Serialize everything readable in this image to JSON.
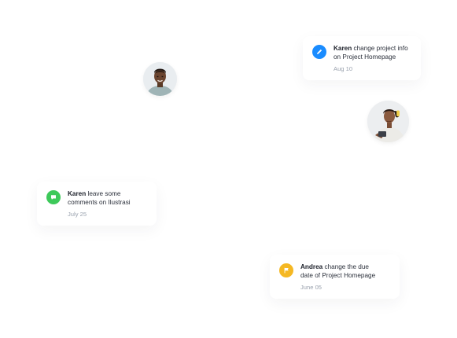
{
  "colors": {
    "pencil_badge": "#1a8cff",
    "comment_badge": "#3dc95a",
    "flag_badge": "#f5b823",
    "background": "#ffffff"
  },
  "activities": [
    {
      "icon": "pencil-icon",
      "user": "Karen",
      "action_line1": "change project info",
      "action_line2": "on Project Homepage",
      "date": "Aug 10"
    },
    {
      "icon": "comment-icon",
      "user": "Karen",
      "action_line1": "leave some",
      "action_line2": "comments on Ilustrasi",
      "date": "July 25"
    },
    {
      "icon": "flag-icon",
      "user": "Andrea",
      "action_line1": "change the due",
      "action_line2": "date of Project Homepage",
      "date": "June 05"
    }
  ]
}
